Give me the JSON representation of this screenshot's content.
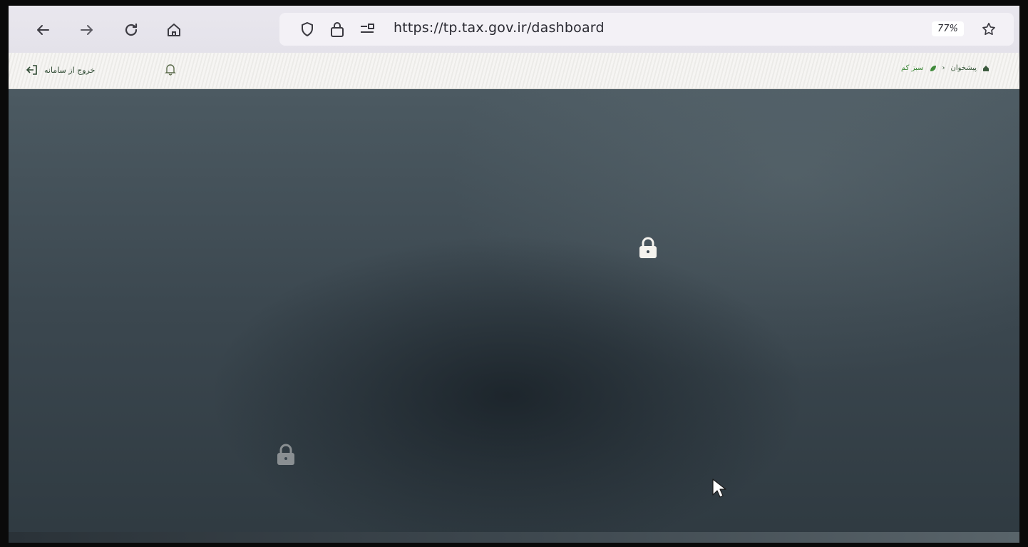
{
  "browser": {
    "url": "https://tp.tax.gov.ir/dashboard",
    "zoom": "77%",
    "icons": {
      "back": "arrow-left-icon",
      "forward": "arrow-right-icon",
      "reload": "reload-icon",
      "home": "home-icon",
      "tracking": "shield-icon",
      "secure": "lock-icon",
      "permissions": "permissions-icon",
      "bookmark": "star-icon"
    }
  },
  "app_header": {
    "logout_label": "خروج از سامانه",
    "breadcrumb": {
      "home": "پیشخوان",
      "current": "سبز کم"
    }
  },
  "overlay": {
    "locks": [
      "lock-icon",
      "lock-icon"
    ],
    "colors": {
      "overlay": "#3b474f",
      "lock_primary": "#f5f3ee",
      "lock_dim": "#8a8f92"
    }
  }
}
